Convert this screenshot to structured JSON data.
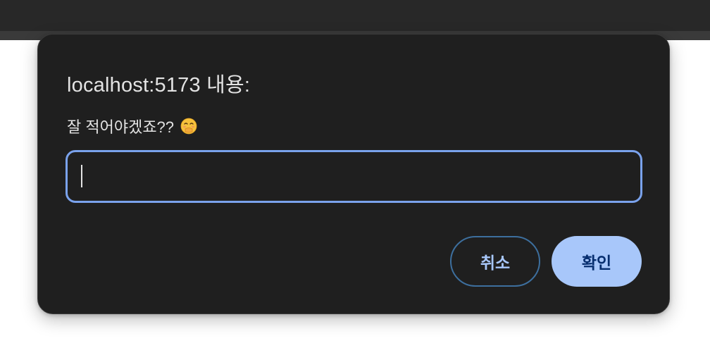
{
  "dialog": {
    "title": "localhost:5173 내용:",
    "message": "잘 적어야겠죠??",
    "message_icon": "face-with-hand-over-mouth-emoji",
    "input": {
      "value": "",
      "placeholder": ""
    },
    "cancel_label": "취소",
    "ok_label": "확인"
  },
  "colors": {
    "dialog_bg": "#1f1f1f",
    "input_focus_border": "#7aa2ec",
    "primary_button_bg": "#a8c7fa",
    "primary_button_text": "#062e6f",
    "secondary_button_text": "#a8c7fa"
  }
}
